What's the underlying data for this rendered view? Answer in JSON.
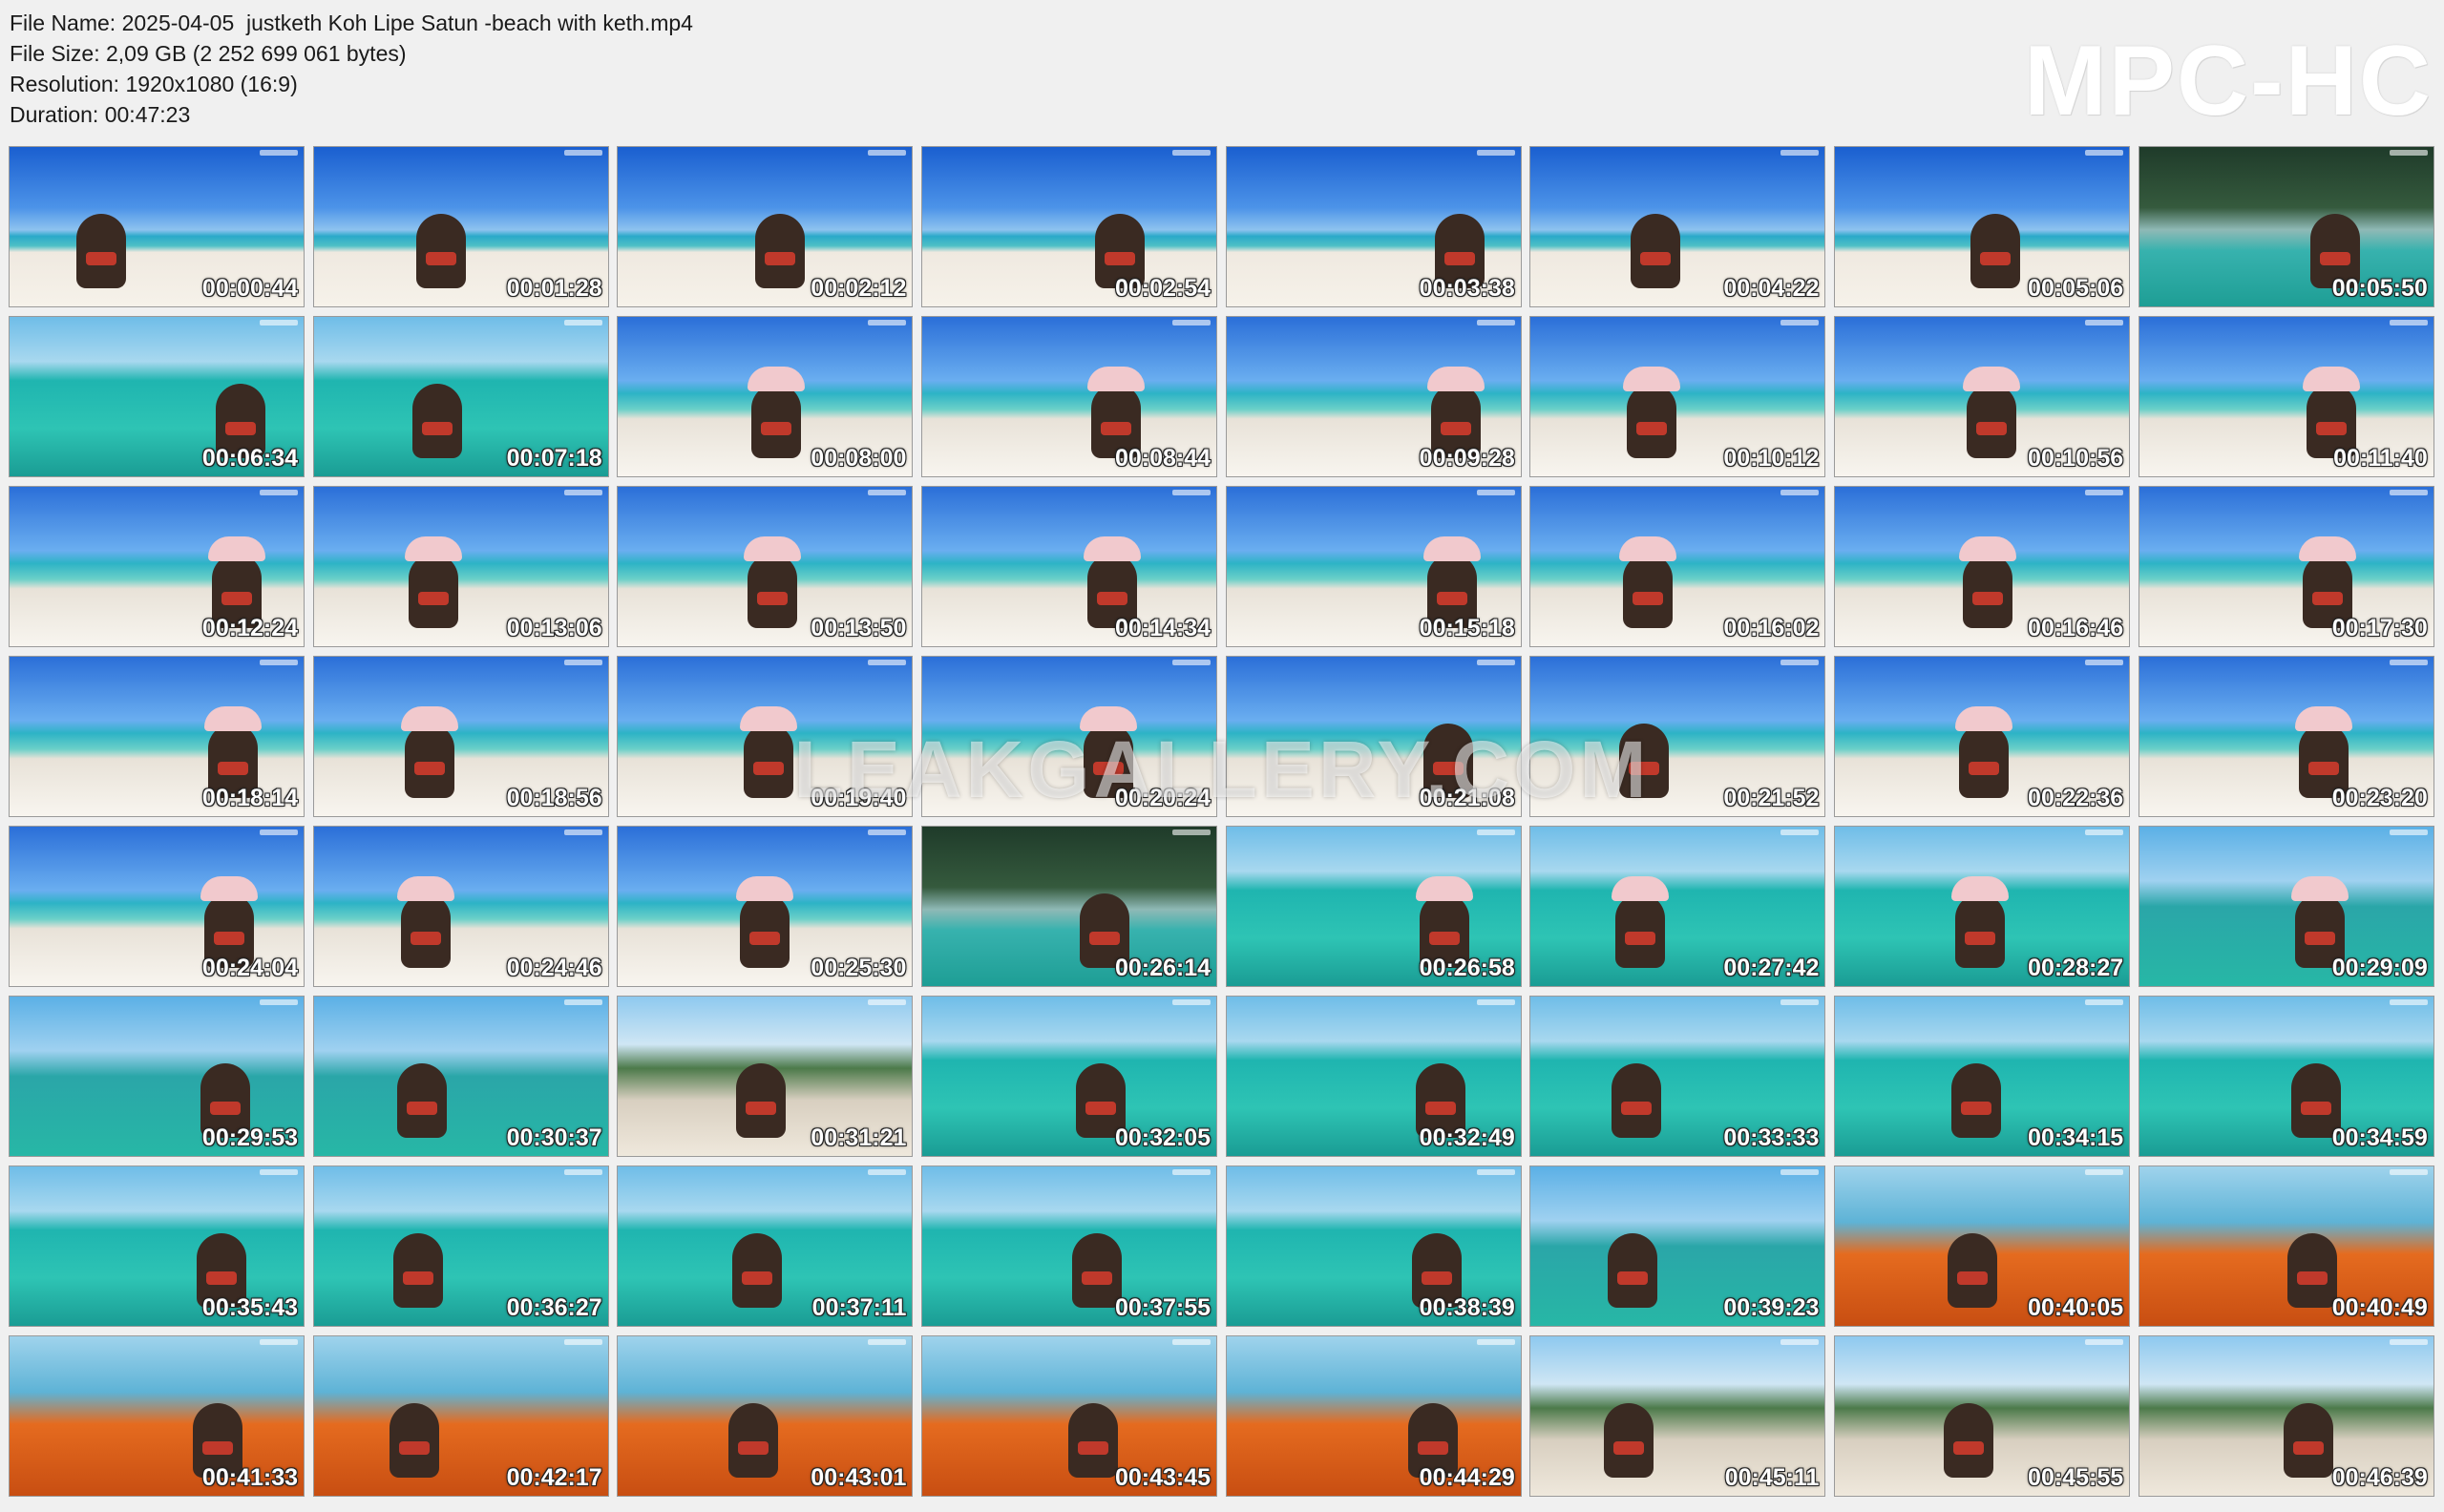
{
  "info": {
    "file_name": "File Name: 2025-04-05  justketh Koh Lipe Satun -beach with keth.mp4",
    "file_size": "File Size: 2,09 GB (2 252 699 061 bytes)",
    "resolution": "Resolution: 1920x1080 (16:9)",
    "duration": "Duration: 00:47:23"
  },
  "logo": "MPC-HC",
  "watermark": "LEAKGALLERY.COM",
  "thumbnails": [
    {
      "ts": "00:00:44",
      "scene": "sky",
      "hat": false
    },
    {
      "ts": "00:01:28",
      "scene": "sky",
      "hat": false
    },
    {
      "ts": "00:02:12",
      "scene": "sky",
      "hat": false
    },
    {
      "ts": "00:02:54",
      "scene": "sky",
      "hat": false
    },
    {
      "ts": "00:03:38",
      "scene": "sky",
      "hat": false
    },
    {
      "ts": "00:04:22",
      "scene": "sky",
      "hat": false
    },
    {
      "ts": "00:05:06",
      "scene": "sky",
      "hat": false
    },
    {
      "ts": "00:05:50",
      "scene": "forest",
      "hat": false
    },
    {
      "ts": "00:06:34",
      "scene": "water",
      "hat": false
    },
    {
      "ts": "00:07:18",
      "scene": "water",
      "hat": false
    },
    {
      "ts": "00:08:00",
      "scene": "sky2",
      "hat": true
    },
    {
      "ts": "00:08:44",
      "scene": "sky2",
      "hat": true
    },
    {
      "ts": "00:09:28",
      "scene": "sky2",
      "hat": true
    },
    {
      "ts": "00:10:12",
      "scene": "sky2",
      "hat": true
    },
    {
      "ts": "00:10:56",
      "scene": "sky2",
      "hat": true
    },
    {
      "ts": "00:11:40",
      "scene": "sky2",
      "hat": true
    },
    {
      "ts": "00:12:24",
      "scene": "sky2",
      "hat": true
    },
    {
      "ts": "00:13:06",
      "scene": "sky2",
      "hat": true
    },
    {
      "ts": "00:13:50",
      "scene": "sky2",
      "hat": true
    },
    {
      "ts": "00:14:34",
      "scene": "sky2",
      "hat": true
    },
    {
      "ts": "00:15:18",
      "scene": "sky2",
      "hat": true
    },
    {
      "ts": "00:16:02",
      "scene": "sky2",
      "hat": true
    },
    {
      "ts": "00:16:46",
      "scene": "sky2",
      "hat": true
    },
    {
      "ts": "00:17:30",
      "scene": "sky2",
      "hat": true
    },
    {
      "ts": "00:18:14",
      "scene": "sky2",
      "hat": true
    },
    {
      "ts": "00:18:56",
      "scene": "sky2",
      "hat": true
    },
    {
      "ts": "00:19:40",
      "scene": "sky2",
      "hat": true
    },
    {
      "ts": "00:20:24",
      "scene": "sky2",
      "hat": true
    },
    {
      "ts": "00:21:08",
      "scene": "sky2",
      "hat": false
    },
    {
      "ts": "00:21:52",
      "scene": "sky2",
      "hat": false
    },
    {
      "ts": "00:22:36",
      "scene": "sky2",
      "hat": true
    },
    {
      "ts": "00:23:20",
      "scene": "sky2",
      "hat": true
    },
    {
      "ts": "00:24:04",
      "scene": "sky2",
      "hat": true
    },
    {
      "ts": "00:24:46",
      "scene": "sky2",
      "hat": true
    },
    {
      "ts": "00:25:30",
      "scene": "sky2",
      "hat": true
    },
    {
      "ts": "00:26:14",
      "scene": "forest",
      "hat": false
    },
    {
      "ts": "00:26:58",
      "scene": "water",
      "hat": true
    },
    {
      "ts": "00:27:42",
      "scene": "water",
      "hat": true
    },
    {
      "ts": "00:28:27",
      "scene": "water",
      "hat": true
    },
    {
      "ts": "00:29:09",
      "scene": "boat",
      "hat": true
    },
    {
      "ts": "00:29:53",
      "scene": "boat",
      "hat": false
    },
    {
      "ts": "00:30:37",
      "scene": "boat",
      "hat": false
    },
    {
      "ts": "00:31:21",
      "scene": "resort",
      "hat": false
    },
    {
      "ts": "00:32:05",
      "scene": "water",
      "hat": false
    },
    {
      "ts": "00:32:49",
      "scene": "water",
      "hat": false
    },
    {
      "ts": "00:33:33",
      "scene": "water",
      "hat": false
    },
    {
      "ts": "00:34:15",
      "scene": "water",
      "hat": false
    },
    {
      "ts": "00:34:59",
      "scene": "water",
      "hat": false
    },
    {
      "ts": "00:35:43",
      "scene": "water",
      "hat": false
    },
    {
      "ts": "00:36:27",
      "scene": "water",
      "hat": false
    },
    {
      "ts": "00:37:11",
      "scene": "water",
      "hat": false
    },
    {
      "ts": "00:37:55",
      "scene": "water",
      "hat": false
    },
    {
      "ts": "00:38:39",
      "scene": "water",
      "hat": false
    },
    {
      "ts": "00:39:23",
      "scene": "boat",
      "hat": false
    },
    {
      "ts": "00:40:05",
      "scene": "orange",
      "hat": false
    },
    {
      "ts": "00:40:49",
      "scene": "orange",
      "hat": false
    },
    {
      "ts": "00:41:33",
      "scene": "orange",
      "hat": false
    },
    {
      "ts": "00:42:17",
      "scene": "orange",
      "hat": false
    },
    {
      "ts": "00:43:01",
      "scene": "orange",
      "hat": false
    },
    {
      "ts": "00:43:45",
      "scene": "orange",
      "hat": false
    },
    {
      "ts": "00:44:29",
      "scene": "orange",
      "hat": false
    },
    {
      "ts": "00:45:11",
      "scene": "resort",
      "hat": false
    },
    {
      "ts": "00:45:55",
      "scene": "resort",
      "hat": false
    },
    {
      "ts": "00:46:39",
      "scene": "resort",
      "hat": false
    }
  ]
}
